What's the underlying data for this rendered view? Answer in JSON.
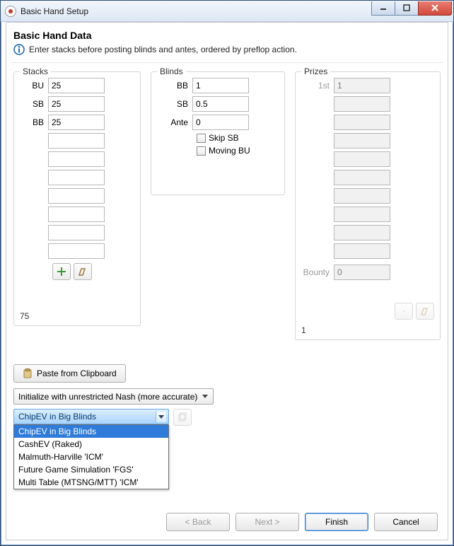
{
  "window": {
    "title": "Basic Hand Setup"
  },
  "header": {
    "title": "Basic Hand Data",
    "info": "Enter stacks before posting blinds and antes, ordered by preflop action."
  },
  "stacks": {
    "legend": "Stacks",
    "rows": [
      {
        "label": "BU",
        "value": "25"
      },
      {
        "label": "SB",
        "value": "25"
      },
      {
        "label": "BB",
        "value": "25"
      },
      {
        "label": "",
        "value": ""
      },
      {
        "label": "",
        "value": ""
      },
      {
        "label": "",
        "value": ""
      },
      {
        "label": "",
        "value": ""
      },
      {
        "label": "",
        "value": ""
      },
      {
        "label": "",
        "value": ""
      },
      {
        "label": "",
        "value": ""
      }
    ],
    "total": "75"
  },
  "blinds": {
    "legend": "Blinds",
    "bb_label": "BB",
    "bb_value": "1",
    "sb_label": "SB",
    "sb_value": "0.5",
    "ante_label": "Ante",
    "ante_value": "0",
    "skip_sb_label": "Skip SB",
    "moving_bu_label": "Moving BU"
  },
  "prizes": {
    "legend": "Prizes",
    "first_label": "1st",
    "first_value": "1",
    "bounty_label": "Bounty",
    "bounty_value": "0",
    "total": "1"
  },
  "controls": {
    "paste_label": "Paste from Clipboard",
    "init_select": "Initialize with unrestricted Nash (more accurate)",
    "ev_selected": "ChipEV in Big Blinds",
    "ev_options": [
      "ChipEV in Big Blinds",
      "CashEV (Raked)",
      "Malmuth-Harville 'ICM'",
      "Future Game Simulation 'FGS'",
      "Multi Table (MTSNG/MTT) 'ICM'"
    ]
  },
  "wizard": {
    "back": "< Back",
    "next": "Next >",
    "finish": "Finish",
    "cancel": "Cancel"
  }
}
